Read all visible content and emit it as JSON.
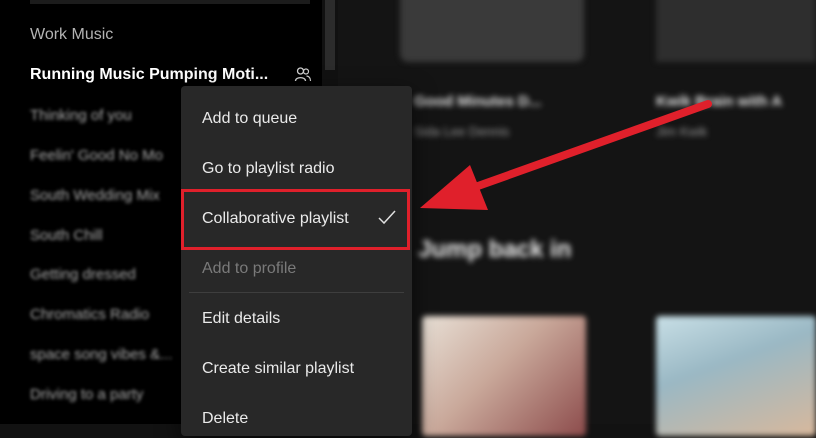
{
  "sidebar": {
    "playlists": [
      "Work Music",
      "Running Music Pumping Moti...",
      "Thinking of you",
      "Feelin' Good No Mo",
      "South Wedding Mix",
      "South Chill",
      "Getting dressed",
      "Chromatics Radio",
      "space song vibes &...",
      "Driving to a party"
    ]
  },
  "main": {
    "cards": [
      {
        "title": "Good Minutes D...",
        "subtitle": "Sida Lee Dennis"
      },
      {
        "title": "Kwik Brain with A",
        "subtitle": "Jim Kwik"
      }
    ],
    "section_heading": "Jump back in"
  },
  "context_menu": {
    "items": [
      "Add to queue",
      "Go to playlist radio",
      "Collaborative playlist",
      "Add to profile",
      "Edit details",
      "Create similar playlist",
      "Delete"
    ]
  },
  "colors": {
    "annotation": "#e0202b",
    "menu_bg": "#282828"
  },
  "icons": {
    "collaborative": "collaborative-people-icon",
    "check": "check-icon"
  }
}
